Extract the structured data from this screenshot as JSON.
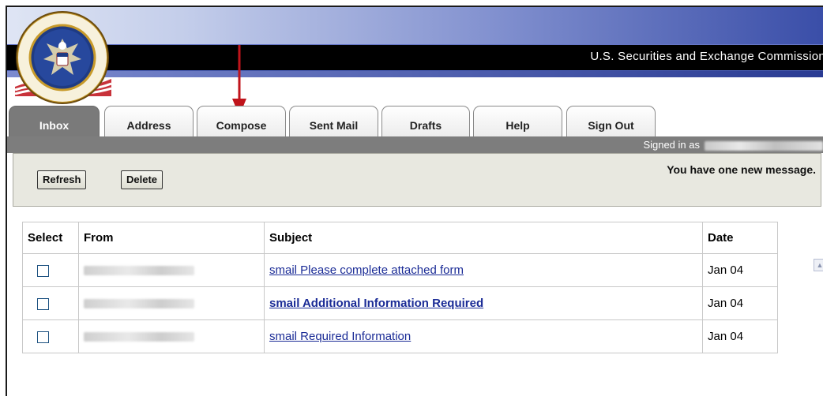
{
  "header": {
    "agency_title": "U.S. Securities and Exchange Commission"
  },
  "tabs": [
    {
      "label": "Inbox",
      "active": true
    },
    {
      "label": "Address",
      "active": false
    },
    {
      "label": "Compose",
      "active": false
    },
    {
      "label": "Sent Mail",
      "active": false
    },
    {
      "label": "Drafts",
      "active": false
    },
    {
      "label": "Help",
      "active": false
    },
    {
      "label": "Sign Out",
      "active": false
    }
  ],
  "session": {
    "signed_in_label": "Signed in as"
  },
  "toolbar": {
    "refresh_label": "Refresh",
    "delete_label": "Delete",
    "status_message": "You have one new message."
  },
  "table": {
    "columns": [
      "Select",
      "From",
      "Subject",
      "Date"
    ],
    "rows": [
      {
        "subject": "smail Please complete attached form",
        "date": "Jan 04",
        "unread": false,
        "checked": false
      },
      {
        "subject": "smail Additional Information Required",
        "date": "Jan 04",
        "unread": true,
        "checked": false
      },
      {
        "subject": "smail Required Information",
        "date": "Jan 04",
        "unread": false,
        "checked": false
      }
    ]
  },
  "colors": {
    "header_black": "#000000",
    "header_blue": "#3a4ea8",
    "tab_bar_gray": "#7d7d7d",
    "link_blue": "#1a2b96",
    "annotation_arrow": "#c0141b"
  },
  "icons": {
    "seal": "sec-seal-icon",
    "flag": "flag-icon",
    "arrow": "annotation-arrow-icon"
  }
}
